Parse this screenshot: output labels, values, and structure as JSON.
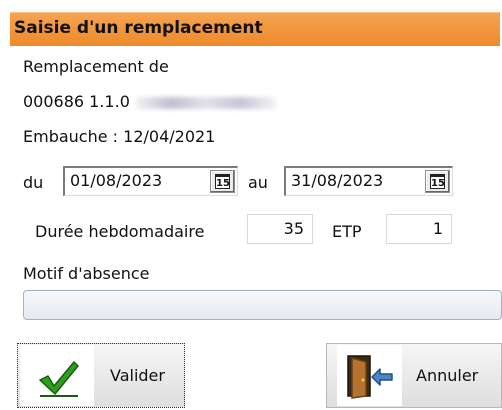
{
  "window": {
    "title": "Saisie d'un remplacement"
  },
  "form": {
    "replacement_label": "Remplacement de",
    "employee_code": "000686 1.1.0",
    "hire_label": "Embauche : 12/04/2021",
    "from_label": "du",
    "from_date": "01/08/2023",
    "to_label": "au",
    "to_date": "31/08/2023",
    "calendar_day": "15",
    "weekly_hours_label": "Durée hebdomadaire",
    "weekly_hours": "35",
    "etp_label": "ETP",
    "etp": "1",
    "reason_label": "Motif d'absence",
    "reason_value": ""
  },
  "buttons": {
    "validate": "Valider",
    "cancel": "Annuler"
  },
  "icons": {
    "validate": "green-check-icon",
    "cancel": "exit-door-icon",
    "calendar": "calendar-icon"
  },
  "colors": {
    "title_bar": "#ed8a2a",
    "check": "#2e9e1f"
  }
}
